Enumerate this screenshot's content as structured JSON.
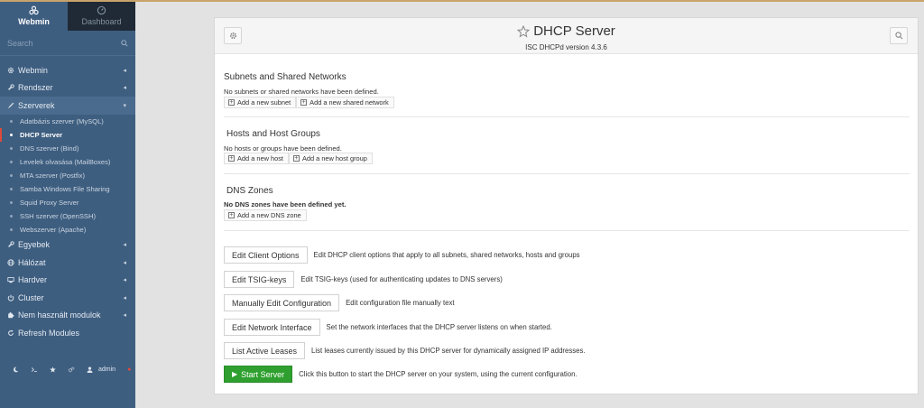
{
  "sidebar": {
    "tabs": [
      {
        "label": "Webmin",
        "icon": "webmin-logo-icon"
      },
      {
        "label": "Dashboard",
        "icon": "dashboard-gauge-icon"
      }
    ],
    "search_placeholder": "Search",
    "menu": [
      {
        "label": "Webmin",
        "icon": "gear-icon"
      },
      {
        "label": "Rendszer",
        "icon": "wrench-icon"
      },
      {
        "label": "Szerverek",
        "icon": "rocket-icon"
      },
      {
        "label": "Egyebek",
        "icon": "wrench-icon"
      },
      {
        "label": "Hálózat",
        "icon": "globe-icon"
      },
      {
        "label": "Hardver",
        "icon": "hardware-icon"
      },
      {
        "label": "Cluster",
        "icon": "power-icon"
      },
      {
        "label": "Nem használt modulok",
        "icon": "puzzle-icon"
      },
      {
        "label": "Refresh Modules",
        "icon": "refresh-icon"
      }
    ],
    "submenu": [
      "Adatbázis szerver (MySQL)",
      "DHCP Server",
      "DNS szerver (Bind)",
      "Levelek olvasása (MailBoxes)",
      "MTA szerver (Postfix)",
      "Samba Windows File Sharing",
      "Squid Proxy Server",
      "SSH szerver (OpenSSH)",
      "Webszerver (Apache)"
    ],
    "footer": {
      "user": "admin"
    }
  },
  "header": {
    "title": "DHCP Server",
    "subtitle": "ISC DHCPd version 4.3.6"
  },
  "subnets": {
    "title": "Subnets and Shared Networks",
    "empty": "No subnets or shared networks have been defined.",
    "add_subnet": "Add a new subnet",
    "add_shared": "Add a new shared network"
  },
  "hosts": {
    "title": "Hosts and Host Groups",
    "empty": "No hosts or groups have been defined.",
    "add_host": "Add a new host",
    "add_group": "Add a new host group"
  },
  "dns": {
    "title": "DNS Zones",
    "empty": "No DNS zones have been defined yet.",
    "add_zone": "Add a new DNS zone"
  },
  "actions": [
    {
      "label": "Edit Client Options",
      "desc": "Edit DHCP client options that apply to all subnets, shared networks, hosts and groups"
    },
    {
      "label": "Edit TSIG-keys",
      "desc": "Edit TSIG-keys (used for authenticating updates to DNS servers)"
    },
    {
      "label": "Manually Edit Configuration",
      "desc": "Edit configuration file manually text"
    },
    {
      "label": "Edit Network Interface",
      "desc": "Set the network interfaces that the DHCP server listens on when started."
    },
    {
      "label": "List Active Leases",
      "desc": "List leases currently issued by this DHCP server for dynamically assigned IP addresses."
    },
    {
      "label": "Start Server",
      "desc": "Click this button to start the DHCP server on your system, using the current configuration."
    }
  ],
  "colors": {
    "sidebar": "#3e5e80",
    "start_button": "#2fa02f",
    "active_marker": "#e04a3a"
  }
}
